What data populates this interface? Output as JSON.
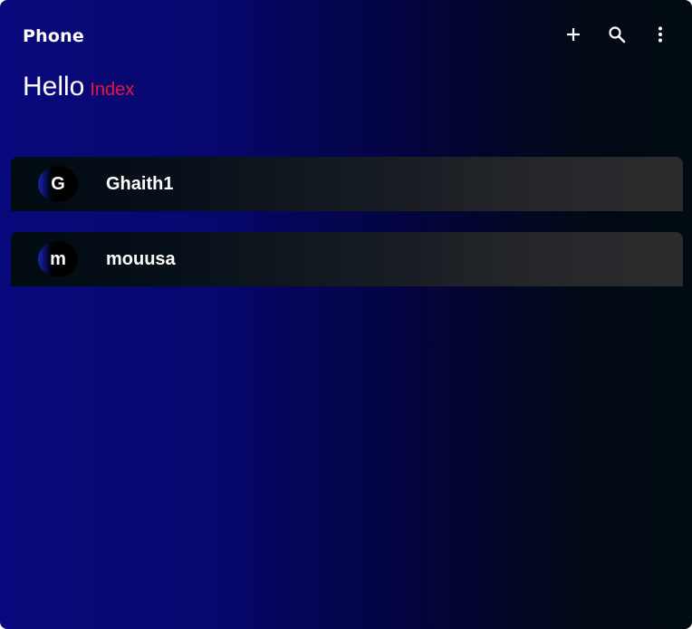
{
  "app_bar": {
    "title": "Phone",
    "actions": [
      {
        "icon": "plus-icon"
      },
      {
        "icon": "search-icon"
      },
      {
        "icon": "more-vertical-icon"
      }
    ]
  },
  "greeting": {
    "hello": "Hello",
    "name": "Index",
    "name_color": "#e8163b"
  },
  "contacts": [
    {
      "initial": "G",
      "name": "Ghaith1"
    },
    {
      "initial": "m",
      "name": "mouusa"
    }
  ]
}
